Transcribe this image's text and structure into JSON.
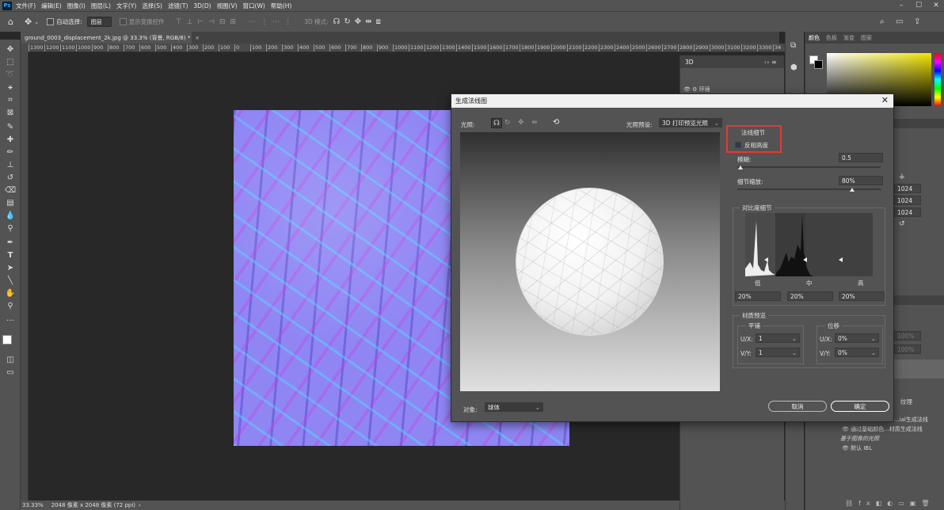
{
  "menu": [
    "文件(F)",
    "编辑(E)",
    "图像(I)",
    "图层(L)",
    "文字(Y)",
    "选择(S)",
    "滤镜(T)",
    "3D(D)",
    "视图(V)",
    "窗口(W)",
    "帮助(H)"
  ],
  "options": {
    "auto_select": "自动选择:",
    "layer": "图层",
    "show_transform": "显示变换控件",
    "mode_3d": "3D 模式:"
  },
  "doc_tab": "ground_0003_displacement_2k.jpg @ 33.3% (背景, RGB/8) *",
  "ruler": [
    "1300",
    "1200",
    "1100",
    "1000",
    "900",
    "800",
    "700",
    "600",
    "500",
    "400",
    "300",
    "200",
    "100",
    "0",
    "100",
    "200",
    "300",
    "400",
    "500",
    "600",
    "700",
    "800",
    "900",
    "1000",
    "1100",
    "1200",
    "1300",
    "1400",
    "1500",
    "1600",
    "1700",
    "1800",
    "1900",
    "2000",
    "2100",
    "2200",
    "2300",
    "2400",
    "2500",
    "2600",
    "2700",
    "2800",
    "2900",
    "3000",
    "3100",
    "3200",
    "3300",
    "34"
  ],
  "status": {
    "zoom": "33.33%",
    "info": "2048 像素 x 2048 像素 (72 ppi)"
  },
  "panel3d": {
    "title": "3D",
    "env": "环境",
    "vals": [
      "1024",
      "1024",
      "1024"
    ],
    "items": [
      "纹理",
      "...ial生成法线",
      "通过基础颜色...材质生成法线",
      "基于图像的光照",
      "默认 IBL"
    ],
    "pct": [
      "100%",
      "100%"
    ]
  },
  "colorpanel": {
    "tabs": [
      "颜色",
      "色板",
      "渐变",
      "图案"
    ]
  },
  "dialog": {
    "title": "生成法线图",
    "light_label": "光照:",
    "preset_label": "光照预设:",
    "preset_value": "3D 打印预览光照",
    "detail_label": "法线细节",
    "invert_label": "反相高度",
    "blur_label": "模糊:",
    "blur_value": "0.5",
    "blur_level": 0.02,
    "detail_scale_label": "细节缩放:",
    "detail_scale_value": "80%",
    "detail_scale_level": 0.8,
    "contrast_title": "对比度细节",
    "low": "低",
    "mid": "中",
    "high": "高",
    "low_val": "20%",
    "mid_val": "20%",
    "high_val": "20%",
    "material_title": "材质预览",
    "tile": "平铺",
    "offset": "位移",
    "ux": "U/X:",
    "vy": "V/Y:",
    "tile_u": "1",
    "tile_v": "1",
    "off_u": "0%",
    "off_v": "0%",
    "object_label": "对象:",
    "object_value": "球体",
    "cancel": "取消",
    "ok": "确定"
  }
}
